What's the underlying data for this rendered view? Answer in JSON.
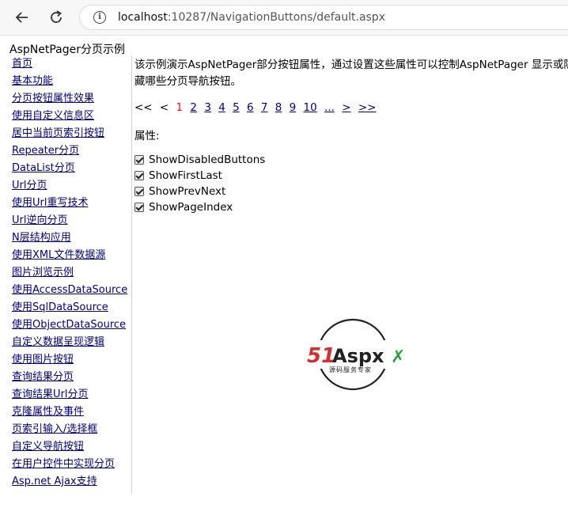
{
  "browser": {
    "url_host": "localhost",
    "url_rest": ":10287/NavigationButtons/default.aspx"
  },
  "page": {
    "title": "AspNetPager分页示例"
  },
  "sidebar": {
    "items": [
      "首页",
      "基本功能",
      "分页按钮属性效果",
      "使用自定义信息区",
      "居中当前页索引按钮",
      "Repeater分页",
      "DataList分页",
      "Url分页",
      "使用Url重写技术",
      "Url逆向分页",
      "N层结构应用",
      "使用XML文件数据源",
      "图片浏览示例",
      "使用AccessDataSource",
      "使用SqlDataSource",
      "使用ObjectDataSource",
      "自定义数据呈现逻辑",
      "使用图片按钮",
      "查询结果分页",
      "查询结果Url分页",
      "克隆属性及事件",
      "页索引输入/选择框",
      "自定义导航按钮",
      "在用户控件中实现分页",
      "Asp.net Ajax支持"
    ]
  },
  "main": {
    "description": "该示例演示AspNetPager部分按钮属性，通过设置这些属性可以控制AspNetPager 显示或隐藏哪些分页导航按钮。",
    "pager": {
      "first": "<<",
      "prev": "<",
      "current": "1",
      "pages": [
        "2",
        "3",
        "4",
        "5",
        "6",
        "7",
        "8",
        "9",
        "10"
      ],
      "more": "...",
      "next": ">",
      "last": ">>"
    },
    "props_label": "属性:",
    "checkboxes": [
      {
        "label": "ShowDisabledButtons",
        "checked": true
      },
      {
        "label": "ShowFirstLast",
        "checked": true
      },
      {
        "label": "ShowPrevNext",
        "checked": true
      },
      {
        "label": "ShowPageIndex",
        "checked": true
      }
    ]
  },
  "logo": {
    "text": "51Aspx",
    "tagline": "源码服务专家"
  },
  "colors": {
    "link": "#00007a",
    "current_page": "#e11111",
    "logo_red": "#d32f2f",
    "logo_green": "#2e9e3e"
  }
}
